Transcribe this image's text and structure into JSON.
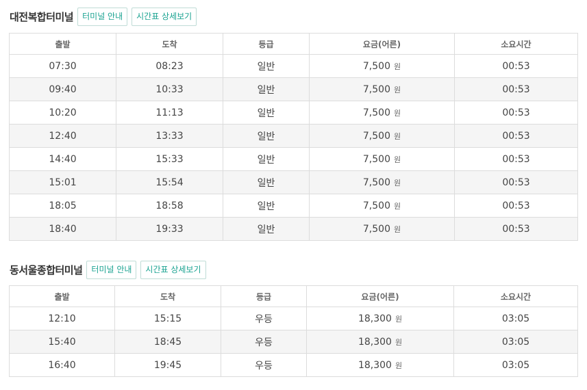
{
  "sections": [
    {
      "terminal": "대전복합터미널",
      "info_button": "터미널 안내",
      "schedule_button": "시간표 상세보기",
      "columns": [
        "출발",
        "도착",
        "등급",
        "요금(어른)",
        "소요시간"
      ],
      "currency": "원",
      "rows": [
        {
          "depart": "07:30",
          "arrive": "08:23",
          "grade": "일반",
          "fare": "7,500",
          "duration": "00:53"
        },
        {
          "depart": "09:40",
          "arrive": "10:33",
          "grade": "일반",
          "fare": "7,500",
          "duration": "00:53"
        },
        {
          "depart": "10:20",
          "arrive": "11:13",
          "grade": "일반",
          "fare": "7,500",
          "duration": "00:53"
        },
        {
          "depart": "12:40",
          "arrive": "13:33",
          "grade": "일반",
          "fare": "7,500",
          "duration": "00:53"
        },
        {
          "depart": "14:40",
          "arrive": "15:33",
          "grade": "일반",
          "fare": "7,500",
          "duration": "00:53"
        },
        {
          "depart": "15:01",
          "arrive": "15:54",
          "grade": "일반",
          "fare": "7,500",
          "duration": "00:53"
        },
        {
          "depart": "18:05",
          "arrive": "18:58",
          "grade": "일반",
          "fare": "7,500",
          "duration": "00:53"
        },
        {
          "depart": "18:40",
          "arrive": "19:33",
          "grade": "일반",
          "fare": "7,500",
          "duration": "00:53"
        }
      ]
    },
    {
      "terminal": "동서울종합터미널",
      "info_button": "터미널 안내",
      "schedule_button": "시간표 상세보기",
      "columns": [
        "출발",
        "도착",
        "등급",
        "요금(어른)",
        "소요시간"
      ],
      "currency": "원",
      "rows": [
        {
          "depart": "12:10",
          "arrive": "15:15",
          "grade": "우등",
          "fare": "18,300",
          "duration": "03:05"
        },
        {
          "depart": "15:40",
          "arrive": "18:45",
          "grade": "우등",
          "fare": "18,300",
          "duration": "03:05"
        },
        {
          "depart": "16:40",
          "arrive": "19:45",
          "grade": "우등",
          "fare": "18,300",
          "duration": "03:05"
        }
      ]
    }
  ],
  "colors": {
    "accent": "#1aa391",
    "button_border": "#bfdcd6",
    "stripe": "#f5f5f5",
    "grid": "#dcdcdc"
  }
}
